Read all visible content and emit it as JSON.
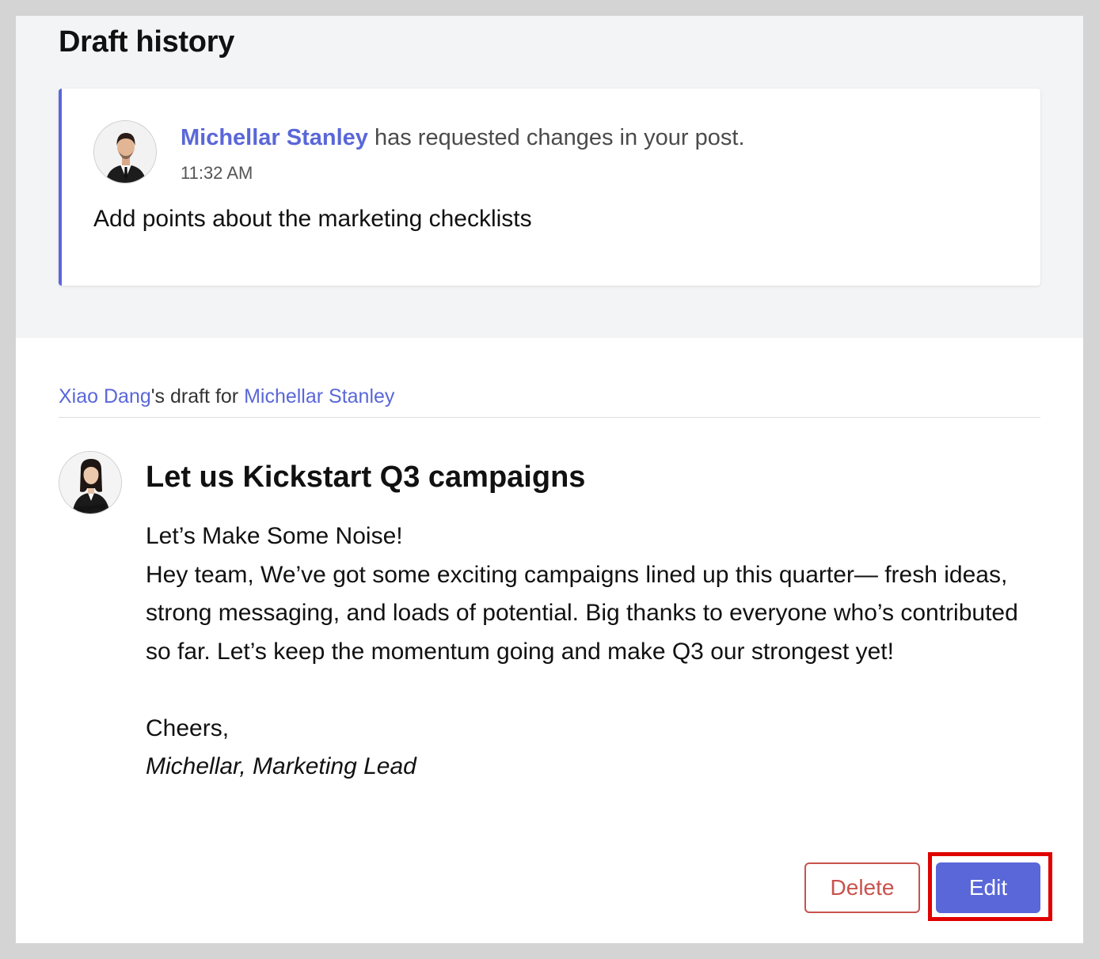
{
  "header": {
    "title": "Draft history"
  },
  "request": {
    "reviewer_name": "Michellar Stanley",
    "message": " has requested changes in your post.",
    "time": "11:32 AM",
    "comment": "Add points about the marketing checklists"
  },
  "draft": {
    "author_name": "Xiao Dang",
    "for_text": "'s draft for ",
    "recipient_name": "Michellar Stanley",
    "title": "Let us Kickstart Q3 campaigns",
    "body": {
      "line1": "Let’s Make Some Noise!",
      "paragraph": "Hey team, We’ve got some exciting campaigns lined up this quarter— fresh ideas, strong messaging, and loads of potential. Big thanks to everyone who’s contributed so far. Let’s keep the momentum going and make Q3 our strongest yet!",
      "closing": "Cheers,",
      "signature": "Michellar, Marketing Lead"
    }
  },
  "actions": {
    "delete_label": "Delete",
    "edit_label": "Edit"
  },
  "icons": {
    "reviewer_avatar": "avatar-man-in-suit",
    "author_avatar": "avatar-woman-in-blazer"
  },
  "colors": {
    "accent": "#5a67d8",
    "danger": "#c9524e",
    "highlight": "#e00000",
    "top_background": "#f3f4f6",
    "page_background": "#d4d4d4"
  }
}
